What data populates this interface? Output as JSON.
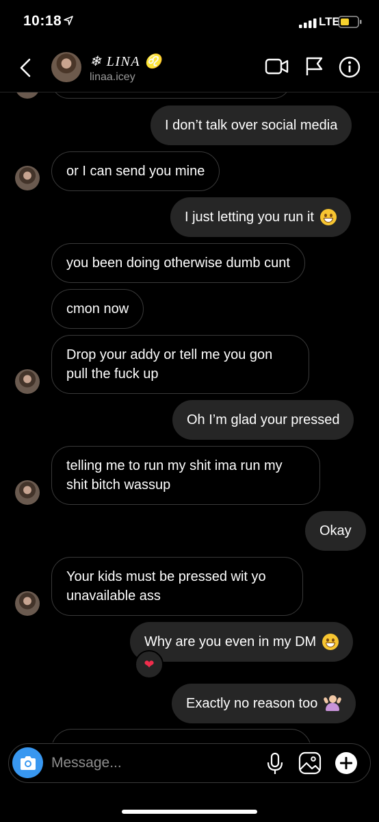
{
  "status_bar": {
    "time": "10:18",
    "network": "LTE"
  },
  "header": {
    "name": "❄ LINA ♌",
    "username": "linaa.icey"
  },
  "messages": [
    {
      "dir": "out",
      "text": "I don’t talk over social media"
    },
    {
      "dir": "in",
      "text": "or I can send you mine"
    },
    {
      "dir": "out",
      "text": "I just letting you run it"
    },
    {
      "dir": "in",
      "text": "you been doing otherwise dumb cunt"
    },
    {
      "dir": "in",
      "text": "cmon now"
    },
    {
      "dir": "in",
      "text": "Drop your addy or tell me you gon pull the fuck up"
    },
    {
      "dir": "out",
      "text": "Oh I’m glad your pressed"
    },
    {
      "dir": "in",
      "text": "telling me to run my shit ima run my shit bitch wassup"
    },
    {
      "dir": "out",
      "text": "Okay"
    },
    {
      "dir": "in",
      "text": "Your kids must be pressed wit yo unavailable ass"
    },
    {
      "dir": "out",
      "text": "Why are you even in my DM",
      "reaction": "❤"
    },
    {
      "dir": "out",
      "text": "Exactly no reason too"
    }
  ],
  "composer": {
    "placeholder": "Message..."
  }
}
